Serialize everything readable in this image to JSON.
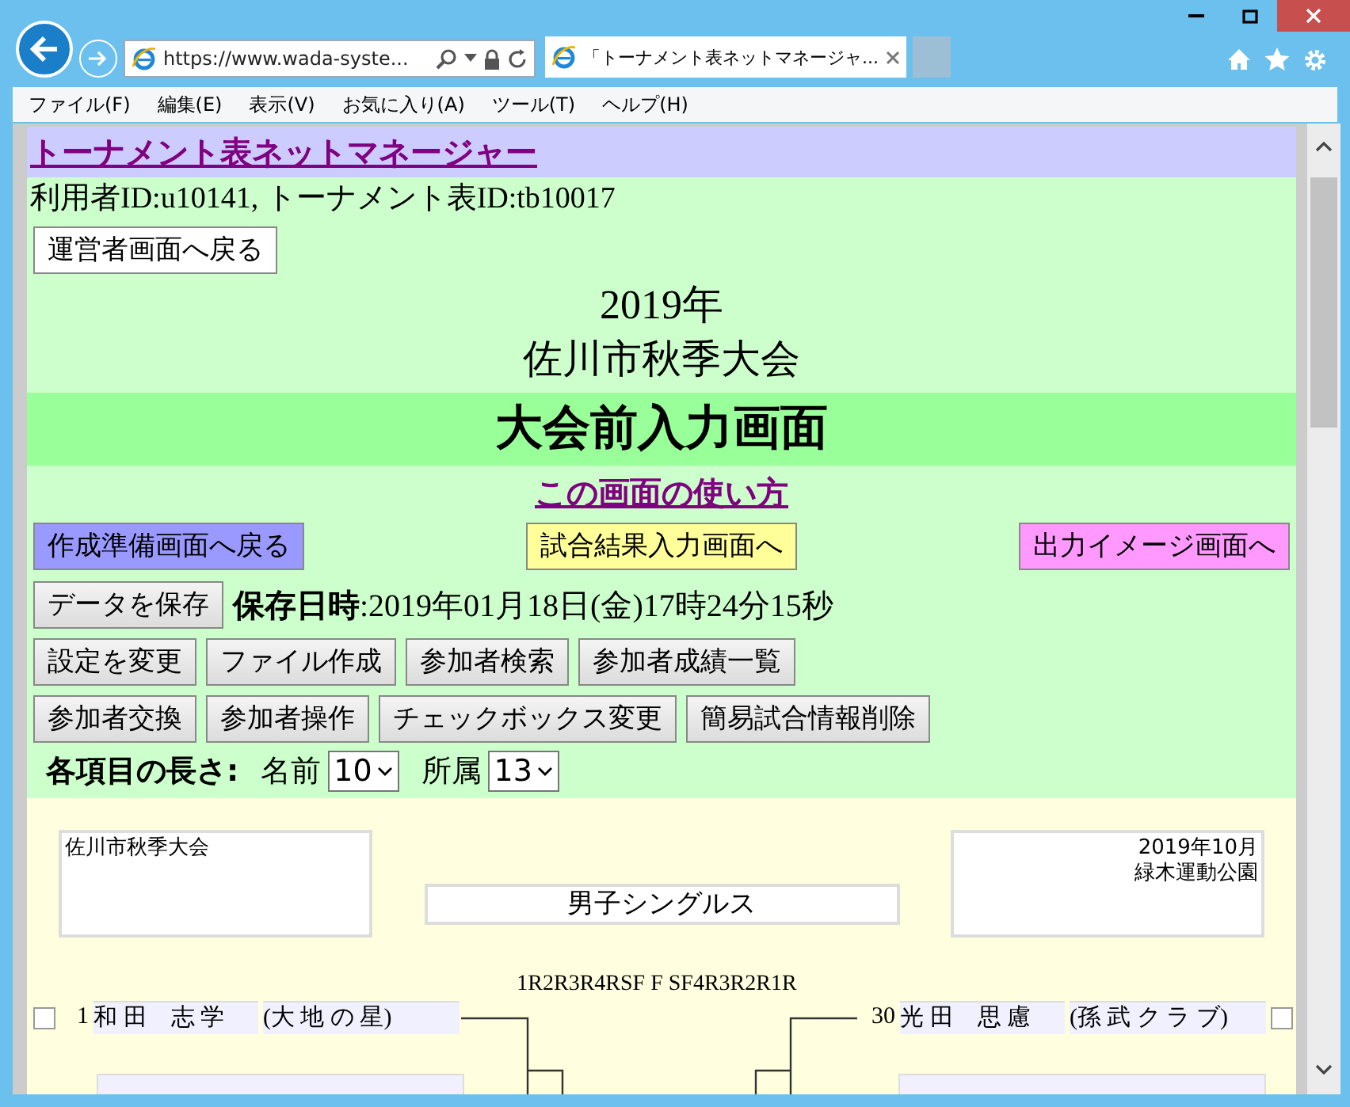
{
  "browser": {
    "url": "https://www.wada-syste...",
    "tab_title": "「トーナメント表ネットマネージャ...",
    "menu": [
      "ファイル(F)",
      "編集(E)",
      "表示(V)",
      "お気に入り(A)",
      "ツール(T)",
      "ヘルプ(H)"
    ]
  },
  "page": {
    "app_link": "トーナメント表ネットマネージャー",
    "ids": "利用者ID:u10141, トーナメント表ID:tb10017",
    "back_button": "運営者画面へ戻る",
    "year": "2019年",
    "event": "佐川市秋季大会",
    "heading": "大会前入力画面",
    "help_link": "この画面の使い方",
    "nav_buttons": [
      {
        "label": "作成準備画面へ戻る",
        "color": "#9999ff"
      },
      {
        "label": "試合結果入力画面へ",
        "color": "#ffff99"
      },
      {
        "label": "出力イメージ画面へ",
        "color": "#ff99ff"
      }
    ],
    "save_button": "データを保存",
    "saved_at": "**保存日時**:2019年01月18日(金)17時24分15秒",
    "tool_rows": [
      [
        "設定を変更",
        "ファイル作成",
        "参加者検索",
        "参加者成績一覧"
      ],
      [
        "参加者交換",
        "参加者操作",
        "チェックボックス変更",
        "簡易試合情報削除"
      ]
    ],
    "lengths": {
      "label": "各項目の長さ:",
      "name_label": "名前",
      "name_value": "10",
      "club_label": "所属",
      "club_value": "13"
    }
  },
  "bracket": {
    "left_box": "佐川市秋季大会",
    "title": "男子シングルス",
    "right_box": [
      "2019年10月",
      "緑木運動公園"
    ],
    "rounds": "1R2R3R4RSF F SF4R3R2R1R",
    "left_players": [
      {
        "number": "1",
        "name": "和 田　志 学",
        "club": "(大 地 の 星)",
        "checked": false
      }
    ],
    "right_players": [
      {
        "number": "30",
        "name": "光 田　思 慮",
        "club": "(孫 武 ク ラ ブ)",
        "checked": false
      }
    ]
  }
}
